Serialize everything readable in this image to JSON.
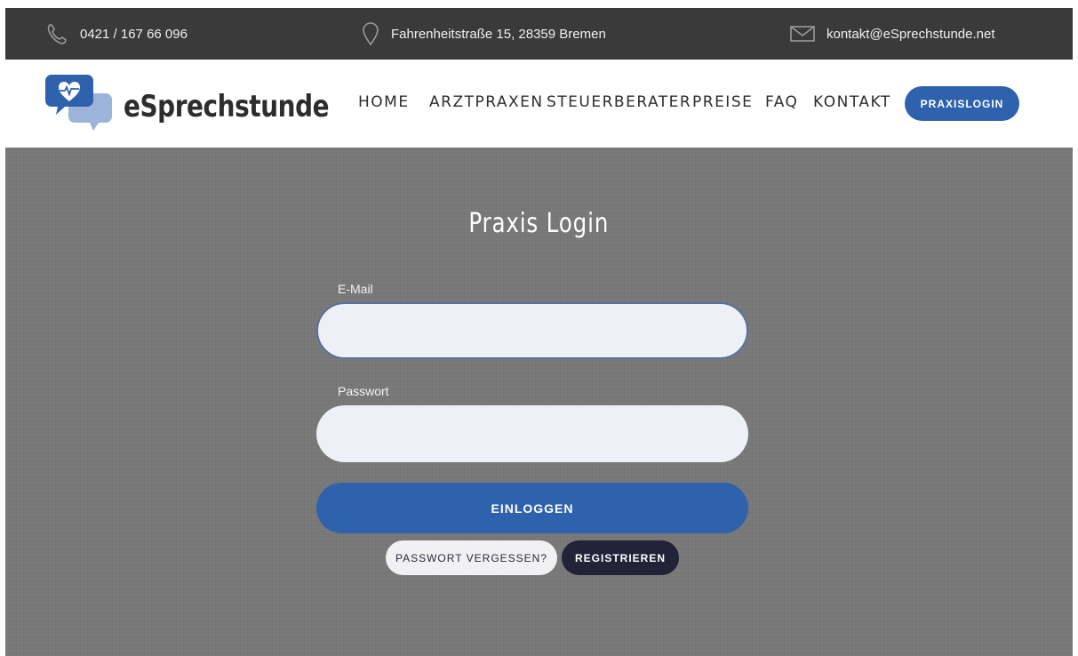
{
  "topbar": {
    "phone": "0421 / 167 66 096",
    "address": "Fahrenheitstraße 15, 28359 Bremen",
    "email": "kontakt@eSprechstunde.net"
  },
  "header": {
    "brand": "eSprechstunde",
    "nav": [
      "HOME",
      "ARZTPRAXEN",
      "STEUERBERATER",
      "PREISE",
      "FAQ",
      "KONTAKT"
    ],
    "login_button": "PRAXISLOGIN"
  },
  "form": {
    "title": "Praxis Login",
    "email_label": "E-Mail",
    "email_value": "",
    "password_label": "Passwort",
    "password_value": "",
    "submit_label": "EINLOGGEN",
    "forgot_label": "PASSWORT VERGESSEN?",
    "register_label": "REGISTRIEREN"
  },
  "colors": {
    "accent": "#2e62ad",
    "topbar": "#3a3a3a",
    "register": "#222238"
  }
}
